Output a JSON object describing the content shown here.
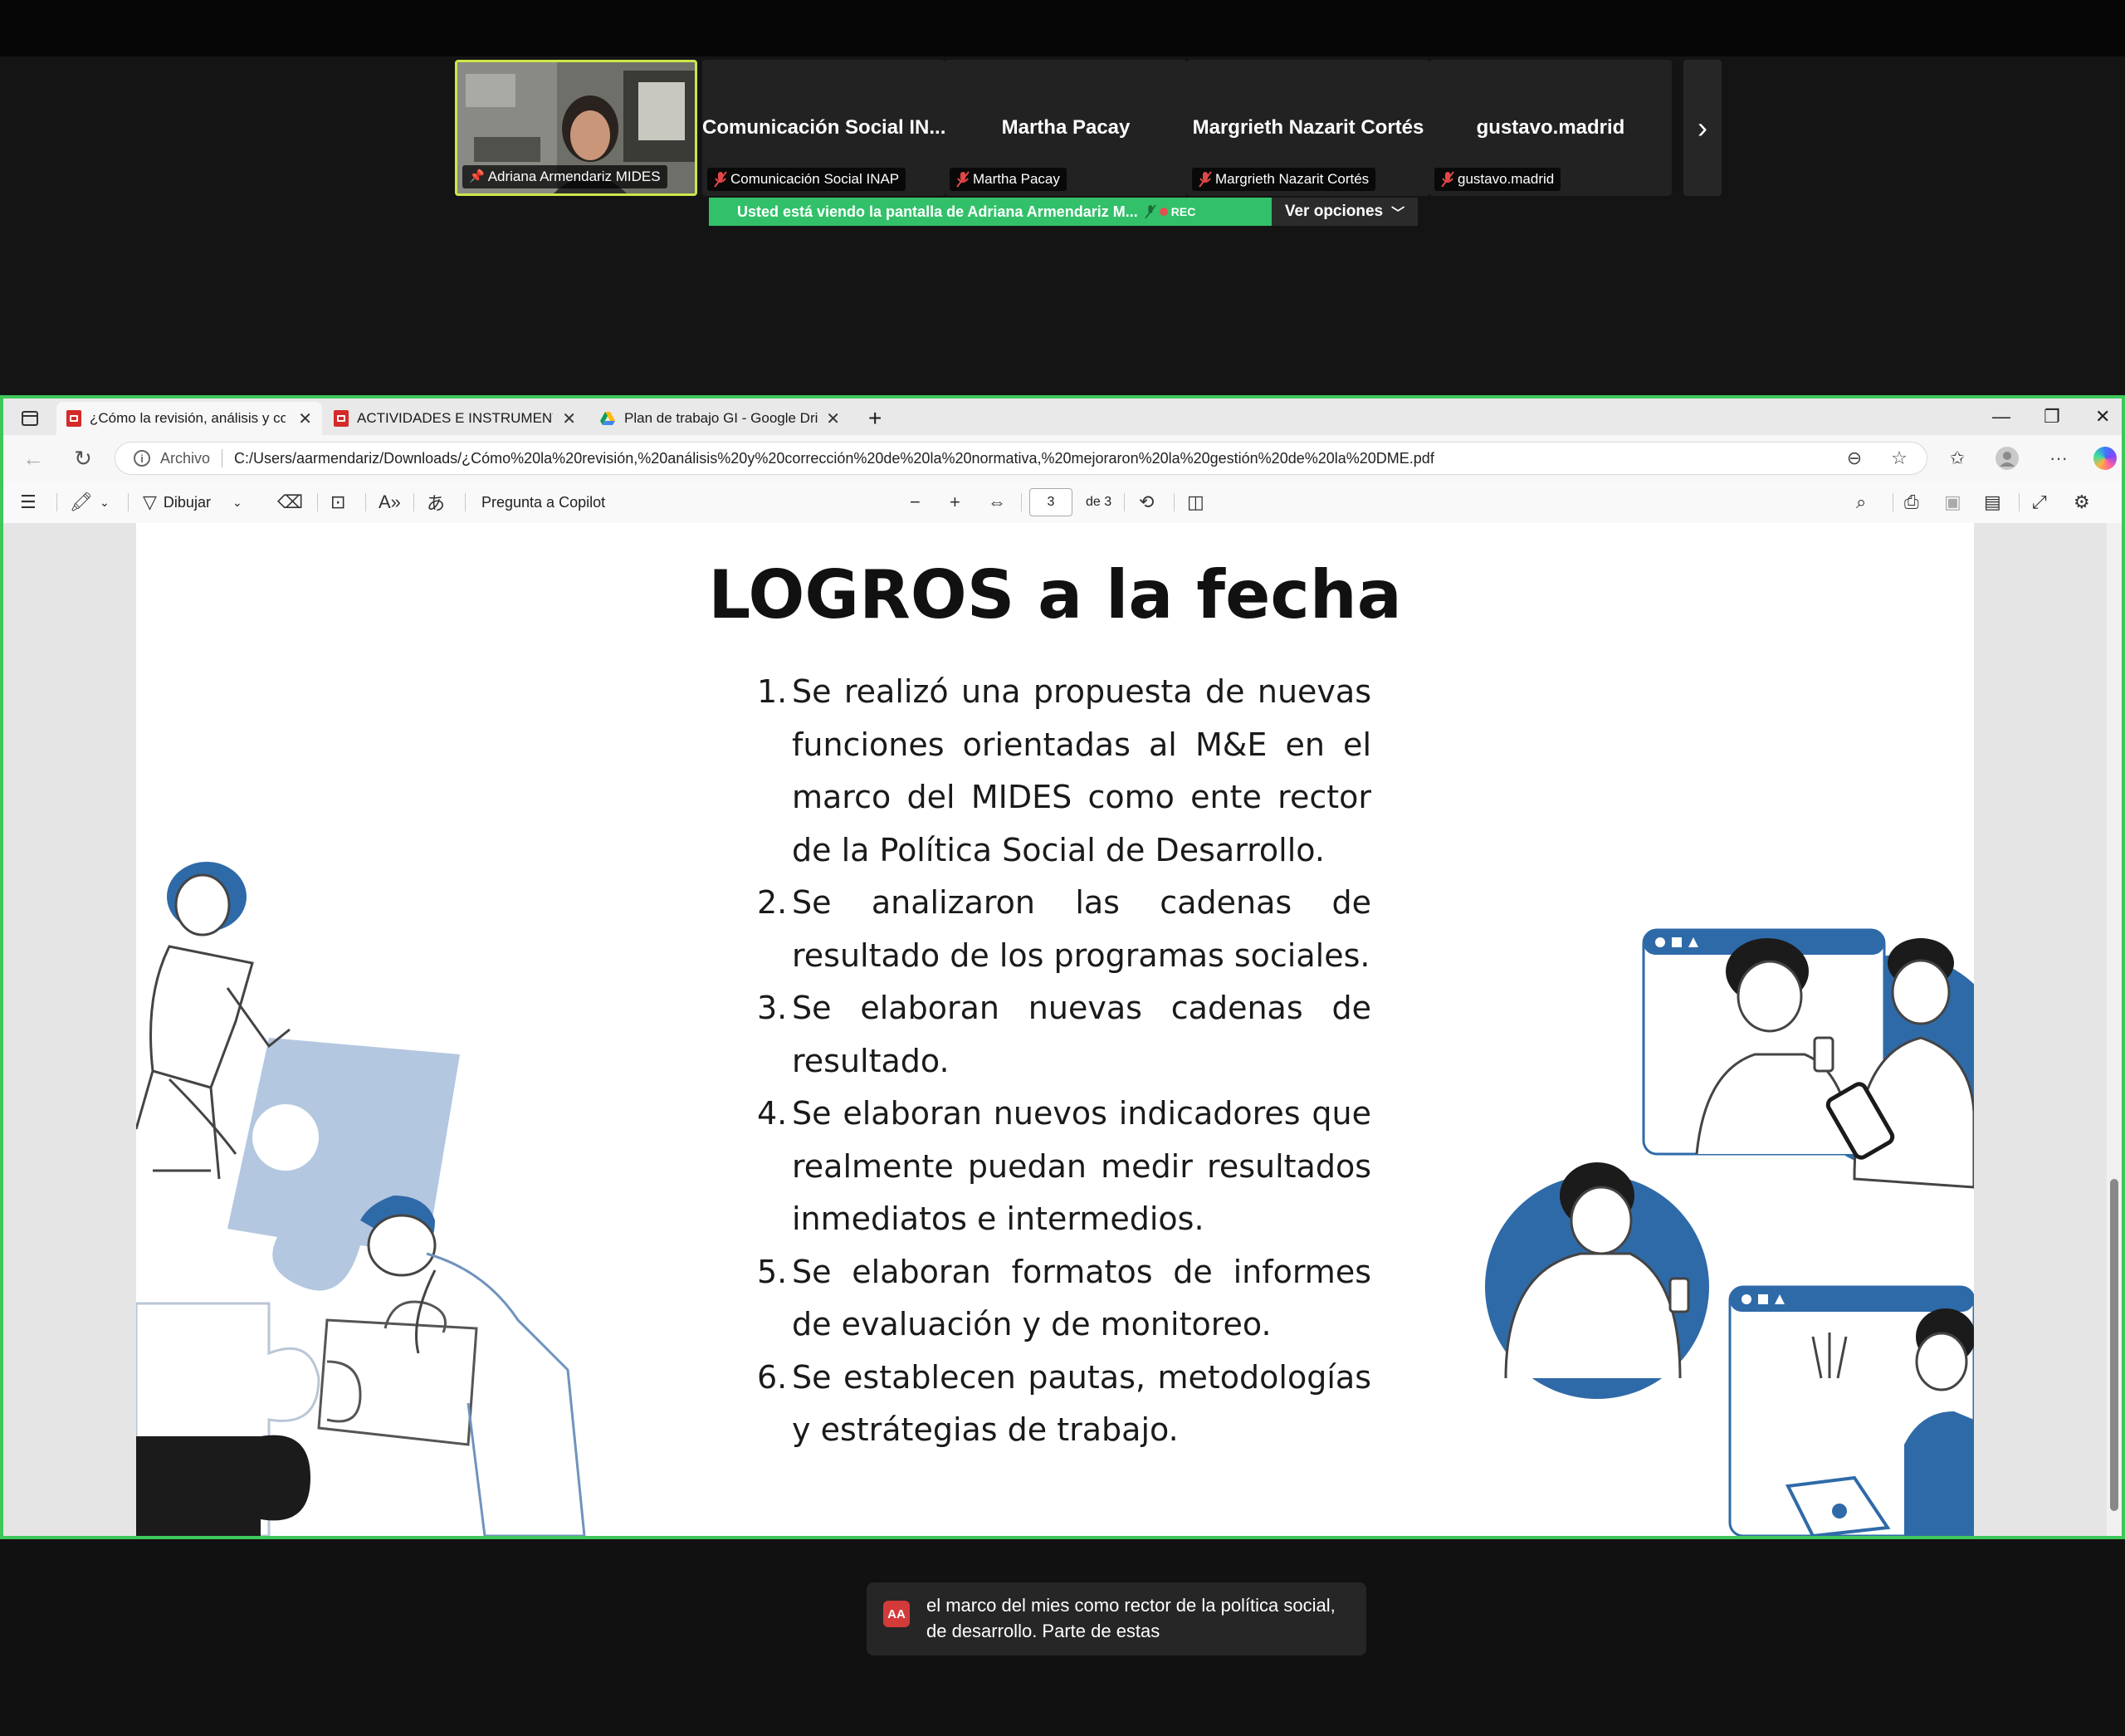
{
  "participants": [
    {
      "name_label": "Adriana Armendariz MIDES",
      "big": ""
    },
    {
      "name_label": "Comunicación Social INAP",
      "big": "Comunicación Social IN..."
    },
    {
      "name_label": "Martha Pacay",
      "big": "Martha Pacay"
    },
    {
      "name_label": "Margrieth Nazarit Cortés",
      "big": "Margrieth Nazarit Cortés"
    },
    {
      "name_label": "gustavo.madrid",
      "big": "gustavo.madrid"
    }
  ],
  "share": {
    "banner": "Usted está viendo la pantalla de  Adriana Armendariz M...",
    "rec": "REC",
    "options": "Ver opciones"
  },
  "browser": {
    "tabs": [
      {
        "label": "¿Cómo la revisión, análisis y corre"
      },
      {
        "label": "ACTIVIDADES E INSTRUMENTOS"
      },
      {
        "label": "Plan de trabajo GI - Google Drive"
      }
    ],
    "address_prefix": "Archivo",
    "url": "C:/Users/aarmendariz/Downloads/¿Cómo%20la%20revisión,%20análisis%20y%20corrección%20de%20la%20normativa,%20mejoraron%20la%20gestión%20de%20la%20DME.pdf"
  },
  "pdf_toolbar": {
    "draw": "Dibujar",
    "copilot": "Pregunta a Copilot",
    "page_current": "3",
    "page_total": "de 3"
  },
  "slide": {
    "title": "LOGROS a la fecha",
    "items": [
      {
        "num": "1.",
        "text": "Se realizó una propuesta de nuevas funciones orientadas al M&E en el marco del MIDES como ente rector de la Política Social de Desarrollo."
      },
      {
        "num": "2.",
        "text": "Se analizaron las cadenas de resultado de los programas sociales."
      },
      {
        "num": "3.",
        "text": "Se elaboran nuevas cadenas de resultado."
      },
      {
        "num": "4.",
        "text": "Se elaboran nuevos indicadores que realmente puedan medir resultados inmediatos e intermedios."
      },
      {
        "num": "5.",
        "text": "Se elaboran formatos de informes de evaluación y de monitoreo."
      },
      {
        "num": "6.",
        "text": "Se establecen pautas, metodologías y estrátegias de trabajo."
      }
    ]
  },
  "caption": {
    "badge": "AA",
    "text": "el marco del mies como rector de la política social, de desarrollo. Parte de estas"
  },
  "colors": {
    "accent_green": "#3ec85a",
    "banner_green": "#32c16a",
    "illustration_blue": "#2f6aa8",
    "illustration_light_blue": "#b3c7e0"
  }
}
